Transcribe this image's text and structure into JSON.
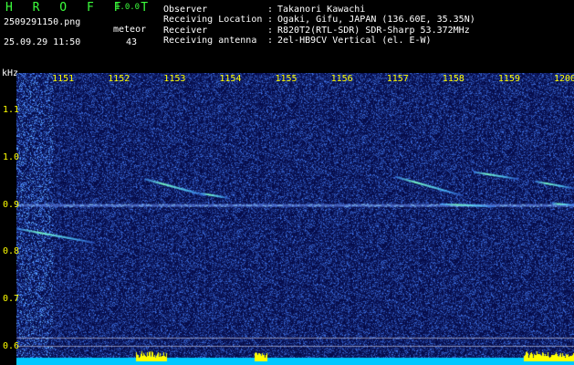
{
  "header": {
    "app_title": "H R O F F T",
    "app_version": "1.0.0",
    "file_name": "2509291150.png",
    "datetime": "25.09.29 11:50",
    "meteor_label": "meteor",
    "meteor_count": "43"
  },
  "info": [
    {
      "key": "Observer",
      "sep": ":",
      "value": "Takanori Kawachi"
    },
    {
      "key": "Receiving Location",
      "sep": ":",
      "value": "Ogaki, Gifu, JAPAN (136.60E, 35.35N)"
    },
    {
      "key": "Receiver",
      "sep": ":",
      "value": "R820T2(RTL-SDR) SDR-Sharp 53.372MHz"
    },
    {
      "key": "Receiving antenna",
      "sep": ":",
      "value": "2el-HB9CV Vertical (el. E-W)"
    }
  ],
  "colors": {
    "background": "#000000",
    "title": "#3cff3c",
    "ticks": "#ffff00",
    "spectrogram_base": "#050a4a",
    "noise_band": "#00c8ff",
    "noise_peak": "#ffff00"
  },
  "chart_data": {
    "type": "heatmap",
    "y_unit_label": "kHz",
    "x_ticks": [
      "1151",
      "1152",
      "1153",
      "1154",
      "1155",
      "1156",
      "1157",
      "1158",
      "1159",
      "1200"
    ],
    "y_ticks": [
      "1.1",
      "1.0",
      "0.9",
      "0.8",
      "0.7",
      "0.6"
    ],
    "x_range_minutes": [
      1150,
      1160
    ],
    "y_range_khz": [
      0.58,
      1.18
    ],
    "carrier_khz": 0.9,
    "meteor_traces": [
      {
        "start_min": 1150.0,
        "end_min": 1151.4,
        "start_khz": 0.85,
        "end_khz": 0.82
      },
      {
        "start_min": 1152.3,
        "end_min": 1153.4,
        "start_khz": 0.955,
        "end_khz": 0.92
      },
      {
        "start_min": 1153.3,
        "end_min": 1153.8,
        "start_khz": 0.925,
        "end_khz": 0.915
      },
      {
        "start_min": 1156.8,
        "end_min": 1158.0,
        "start_khz": 0.96,
        "end_khz": 0.92
      },
      {
        "start_min": 1158.2,
        "end_min": 1159.0,
        "start_khz": 0.97,
        "end_khz": 0.955
      },
      {
        "start_min": 1159.3,
        "end_min": 1160.0,
        "start_khz": 0.95,
        "end_khz": 0.935
      },
      {
        "start_min": 1157.6,
        "end_min": 1158.6,
        "start_khz": 0.902,
        "end_khz": 0.897
      },
      {
        "start_min": 1159.6,
        "end_min": 1160.0,
        "start_khz": 0.903,
        "end_khz": 0.9
      }
    ]
  }
}
